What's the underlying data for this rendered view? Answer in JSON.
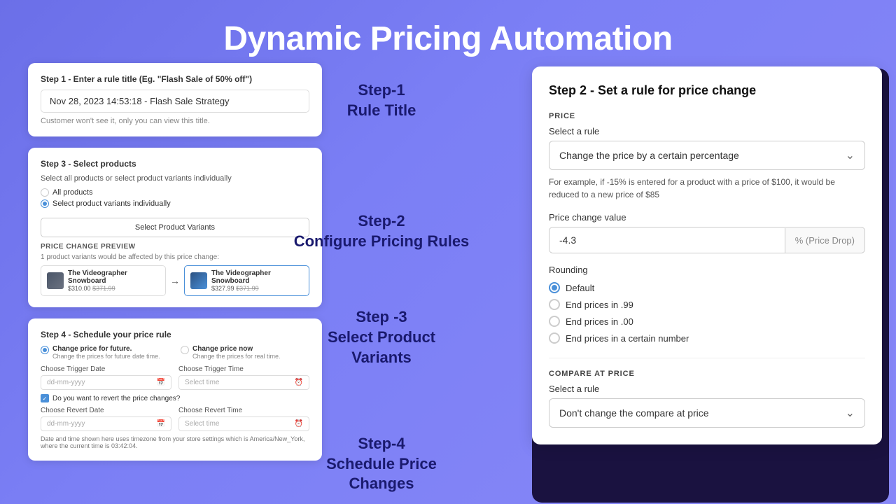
{
  "page": {
    "title": "Dynamic Pricing Automation"
  },
  "step1": {
    "card_title": "Step 1 - Enter a rule title (Eg. \"Flash Sale of 50% off\")",
    "input_value": "Nov 28, 2023 14:53:18 - Flash Sale Strategy",
    "hint": "Customer won't see it, only you can view this title.",
    "label": "Step-1\nRule Title"
  },
  "step2": {
    "label_line1": "Step-2",
    "label_line2": "Configure Pricing Rules"
  },
  "step3": {
    "card_title": "Step 3 - Select products",
    "subtitle": "Select all products or select product variants individually",
    "option1": "All products",
    "option2": "Select product variants individually",
    "btn": "Select Product Variants",
    "preview_label": "PRICE CHANGE PREVIEW",
    "preview_hint": "1 product variants would be affected by this price change:",
    "product1_name": "The Videographer Snowboard",
    "product1_price": "$310.00",
    "product1_old": "$371.99",
    "product2_name": "The Videographer Snowboard",
    "product2_price": "$327.99",
    "product2_old": "$371.99",
    "label_line1": "Step -3",
    "label_line2": "Select Product",
    "label_line3": "Variants"
  },
  "step4": {
    "card_title": "Step 4 - Schedule your price rule",
    "option1_label": "Change price for future.",
    "option1_sub": "Change the prices for future date time.",
    "option2_label": "Change price now",
    "option2_sub": "Change the prices for real time.",
    "trigger_date_label": "Choose Trigger Date",
    "trigger_time_label": "Choose Trigger Time",
    "trigger_date_placeholder": "dd-mm-yyyy",
    "trigger_time_placeholder": "Select time",
    "revert_checkbox": "Do you want to revert the price changes?",
    "revert_date_label": "Choose Revert Date",
    "revert_time_label": "Choose Revert Time",
    "revert_date_placeholder": "dd-mm-yyyy",
    "revert_time_placeholder": "Select time",
    "footer": "Date and time shown here uses timezone from your store settings which is America/New_York, where the current time is 03:42:04.",
    "label_line1": "Step-4",
    "label_line2": "Schedule Price",
    "label_line3": "Changes"
  },
  "right_panel": {
    "title": "Step 2 - Set a rule for price change",
    "price_section": "PRICE",
    "select_rule_label": "Select a rule",
    "select_rule_value": "Change the price by a certain percentage",
    "hint": "For example, if -15% is entered for a product with a price of $100, it would be reduced to a new price of $85",
    "price_change_label": "Price change value",
    "price_change_value": "-4.3",
    "price_change_suffix": "% (Price Drop)",
    "rounding_label": "Rounding",
    "rounding_options": [
      "Default",
      "End prices in .99",
      "End prices in .00",
      "End prices in a certain number"
    ],
    "rounding_selected": "Default",
    "compare_section": "COMPARE AT PRICE",
    "compare_rule_label": "Select a rule",
    "compare_rule_value": "Don't change the compare at price"
  }
}
